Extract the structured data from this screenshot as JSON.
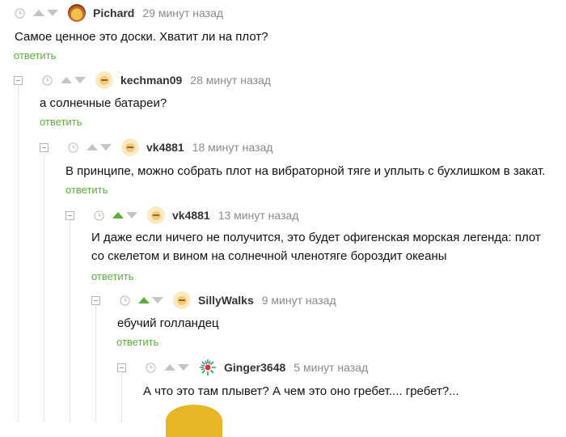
{
  "comments": [
    {
      "author": "Pichard",
      "time": "29 минут назад",
      "text": "Самое ценное это доски. Хватит ли на плот?",
      "reply_label": "ответить",
      "upvoted": false,
      "avatar": "pichard-avatar"
    },
    {
      "author": "kechman09",
      "time": "28 минут назад",
      "text": "а солнечные батареи?",
      "reply_label": "ответить",
      "upvoted": false,
      "avatar": "default-avatar"
    },
    {
      "author": "vk4881",
      "time": "18 минут назад",
      "text": "В принципе, можно собрать плот на вибраторной тяге и уплыть с бухлишком в закат.",
      "reply_label": "ответить",
      "upvoted": false,
      "avatar": "default-avatar"
    },
    {
      "author": "vk4881",
      "time": "13 минут назад",
      "text": "И даже если ничего не получится, это будет офигенская морская легенда: плот со скелетом и вином на солнечной членотяге бороздит океаны",
      "reply_label": "ответить",
      "upvoted": true,
      "avatar": "default-avatar"
    },
    {
      "author": "SillyWalks",
      "time": "9 минут назад",
      "text": "ебучий голландец",
      "reply_label": "ответить",
      "upvoted": true,
      "avatar": "default-avatar"
    },
    {
      "author": "Ginger3648",
      "time": "5 минут назад",
      "text": "А что это там плывет? А чем это оно гребет.... гребет?...",
      "upvoted": false,
      "avatar": "ginger-avatar"
    }
  ],
  "colors": {
    "accent_green": "#5aae3a",
    "vote_inactive": "#c4c4c4",
    "meta_gray": "#8a8a8a",
    "thread_line": "#e2e2e2"
  }
}
